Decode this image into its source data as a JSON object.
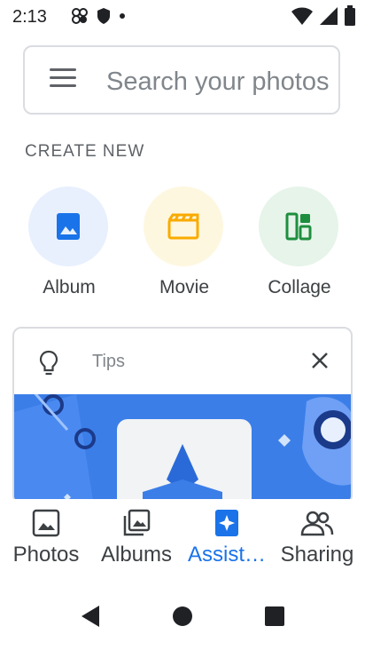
{
  "status": {
    "time": "2:13",
    "icons": [
      "photos-notification-icon",
      "shield-icon",
      "dot-icon",
      "wifi-icon",
      "cellular-icon",
      "battery-icon"
    ]
  },
  "search": {
    "placeholder": "Search your photos",
    "value": ""
  },
  "create_new": {
    "title": "CREATE NEW",
    "items": [
      {
        "label": "Album",
        "icon": "album-icon",
        "bg": "#e8f0fe",
        "color": "#1a73e8"
      },
      {
        "label": "Movie",
        "icon": "movie-icon",
        "bg": "#fef7e0",
        "color": "#f9ab00"
      },
      {
        "label": "Collage",
        "icon": "collage-icon",
        "bg": "#e6f4ea",
        "color": "#1e8e3e"
      }
    ]
  },
  "tips_card": {
    "label": "Tips",
    "icon": "lightbulb-icon",
    "close_icon": "close-icon",
    "image_bg": "#3b7ee8"
  },
  "bottom_nav": {
    "items": [
      {
        "label": "Photos",
        "icon": "photos-icon",
        "active": false
      },
      {
        "label": "Albums",
        "icon": "albums-icon",
        "active": false
      },
      {
        "label": "Assist…",
        "icon": "assistant-icon",
        "active": true
      },
      {
        "label": "Sharing",
        "icon": "sharing-icon",
        "active": false
      }
    ],
    "active_color": "#1a73e8"
  },
  "system_nav": {
    "icons": [
      "back-icon",
      "home-icon",
      "recents-icon"
    ]
  }
}
